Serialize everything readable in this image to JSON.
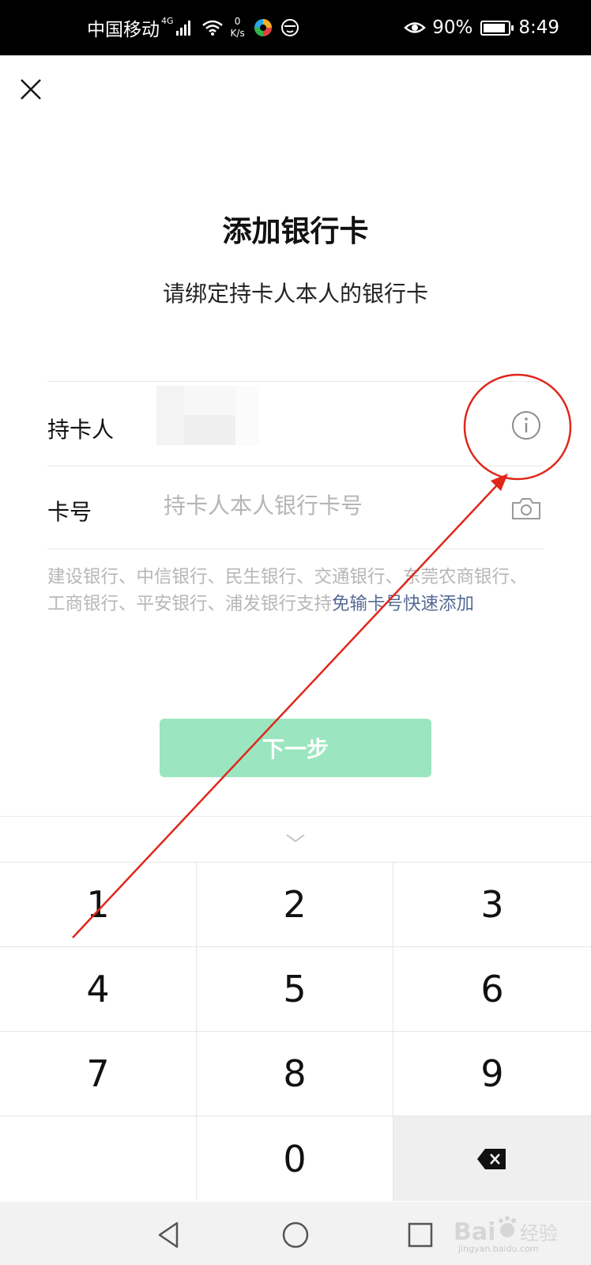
{
  "status_bar": {
    "carrier": "中国移动",
    "network": "4G",
    "speed_value": "0",
    "speed_unit": "K/s",
    "battery_percent": "90%",
    "battery_level": 0.9,
    "time": "8:49"
  },
  "header": {
    "close_icon": "close-icon"
  },
  "page": {
    "title": "添加银行卡",
    "subtitle": "请绑定持卡人本人的银行卡"
  },
  "form": {
    "holder_label": "持卡人",
    "holder_value_icon": "blurred-name",
    "info_icon": "info-icon",
    "card_label": "卡号",
    "card_placeholder": "持卡人本人银行卡号",
    "camera_icon": "camera-icon",
    "support_text": "建设银行、中信银行、民生银行、交通银行、东莞农商银行、工商银行、平安银行、浦发银行支持",
    "support_link": "免输卡号快速添加"
  },
  "next_button": {
    "label": "下一步",
    "color": "#9be6c0"
  },
  "keyboard": {
    "collapse_icon": "chevron-down-icon",
    "keys": [
      "1",
      "2",
      "3",
      "4",
      "5",
      "6",
      "7",
      "8",
      "9",
      "",
      "0",
      "⌫"
    ],
    "delete_icon": "backspace-icon"
  },
  "navbar": {
    "icons": [
      "back-triangle-icon",
      "home-circle-icon",
      "recents-square-icon"
    ]
  },
  "annotation": {
    "color": "#e0261b"
  },
  "watermark": {
    "brand": "Bai",
    "brand_suffix": "经验",
    "url": "jingyan.baidu.com"
  }
}
